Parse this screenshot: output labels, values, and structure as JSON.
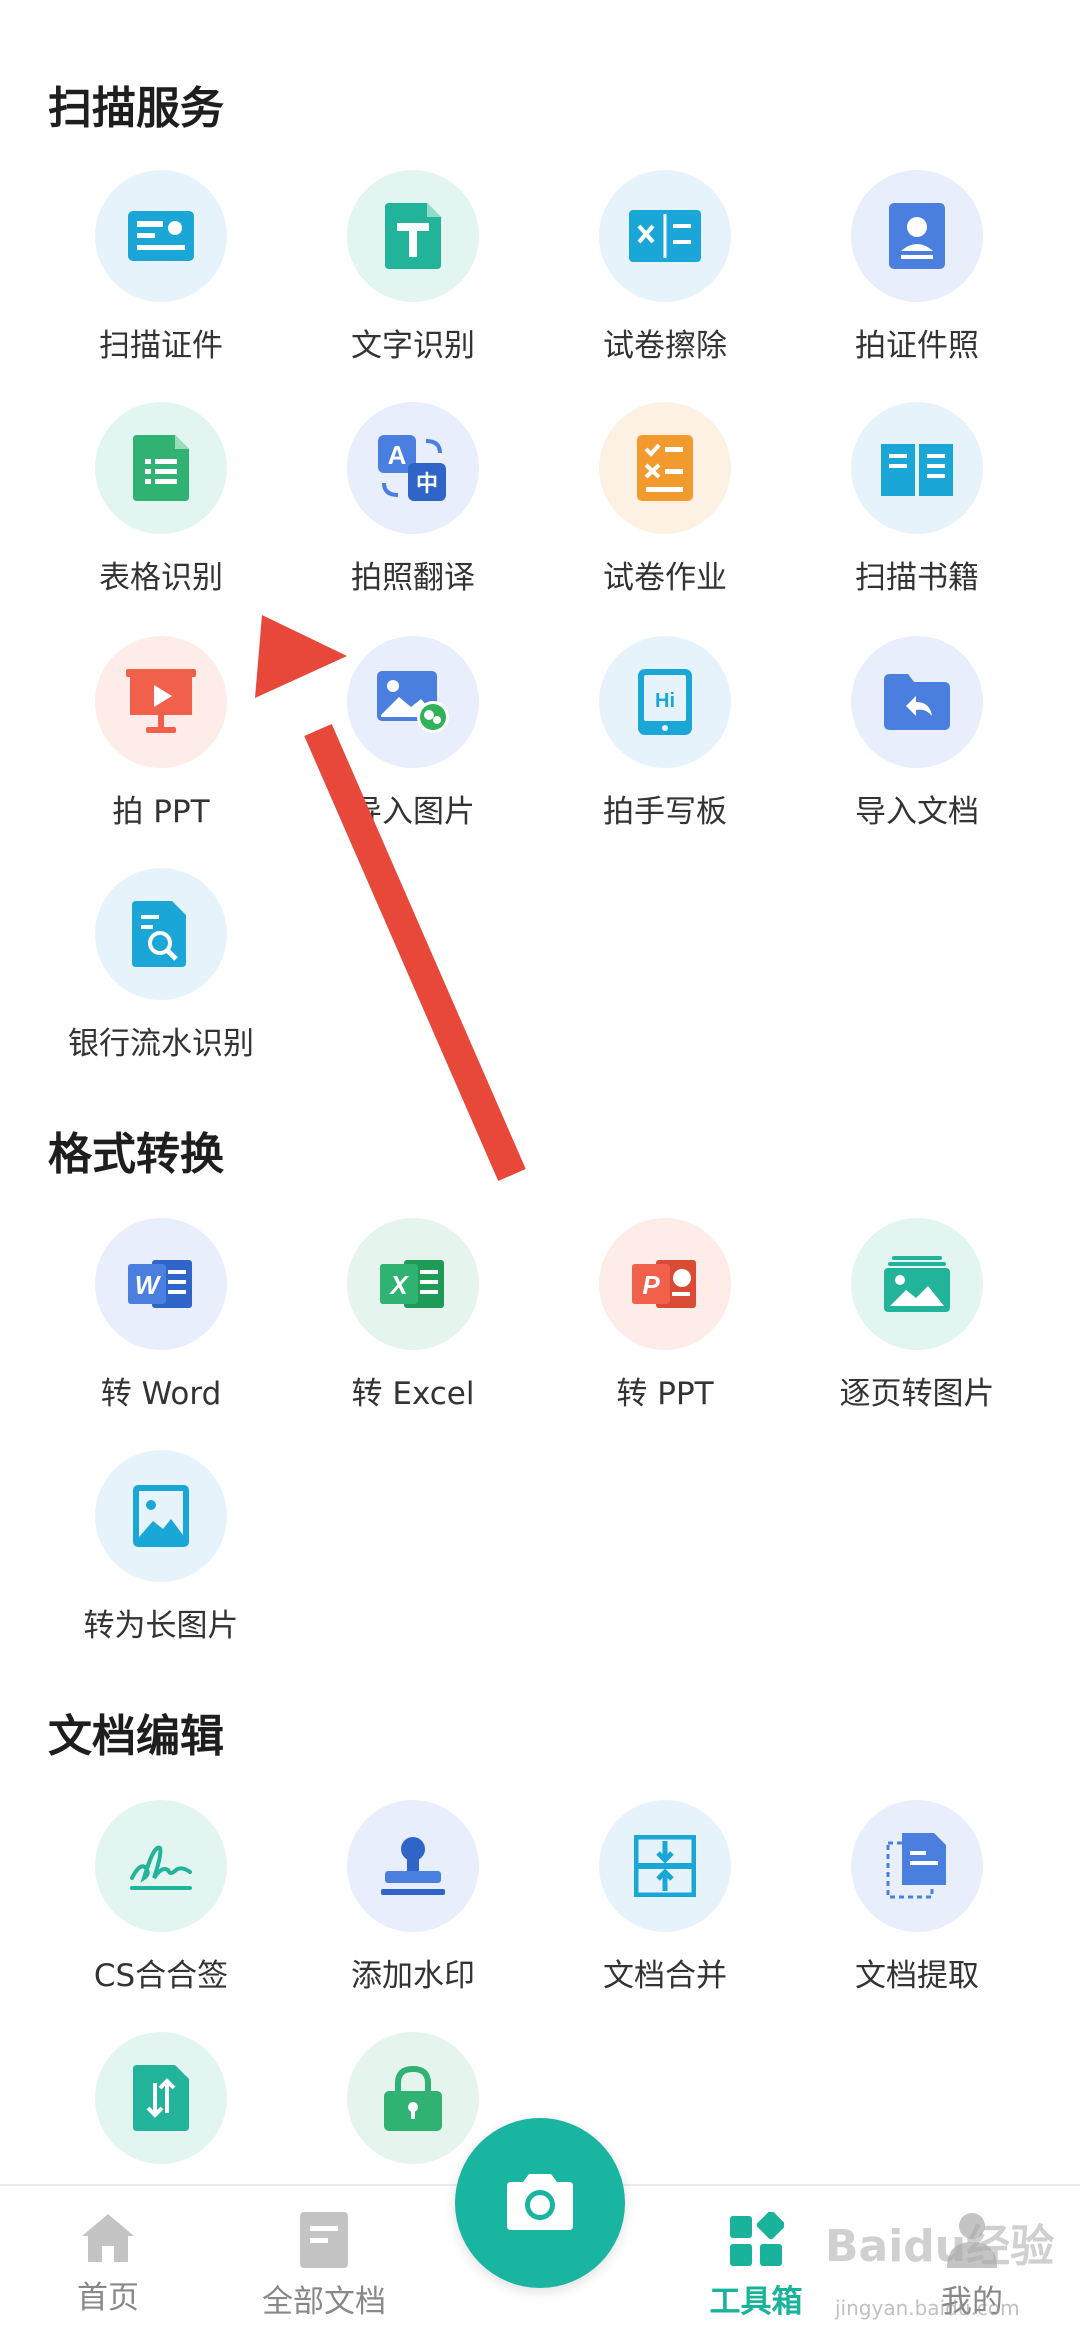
{
  "sections": [
    {
      "title": "扫描服务",
      "tools": [
        {
          "label": "扫描证件",
          "icon": "id-card-icon"
        },
        {
          "label": "文字识别",
          "icon": "text-t-icon"
        },
        {
          "label": "试卷擦除",
          "icon": "erase-book-icon"
        },
        {
          "label": "拍证件照",
          "icon": "id-photo-icon"
        },
        {
          "label": "表格识别",
          "icon": "spreadsheet-icon"
        },
        {
          "label": "拍照翻译",
          "icon": "translate-icon"
        },
        {
          "label": "试卷作业",
          "icon": "homework-icon"
        },
        {
          "label": "扫描书籍",
          "icon": "open-book-icon"
        },
        {
          "label": "拍 PPT",
          "icon": "presentation-icon"
        },
        {
          "label": "导入图片",
          "icon": "import-image-icon"
        },
        {
          "label": "拍手写板",
          "icon": "tablet-icon"
        },
        {
          "label": "导入文档",
          "icon": "import-folder-icon"
        },
        {
          "label": "银行流水识别",
          "icon": "bank-statement-icon"
        }
      ]
    },
    {
      "title": "格式转换",
      "tools": [
        {
          "label": "转 Word",
          "icon": "word-icon"
        },
        {
          "label": "转 Excel",
          "icon": "excel-icon"
        },
        {
          "label": "转 PPT",
          "icon": "ppt-icon"
        },
        {
          "label": "逐页转图片",
          "icon": "pages-to-image-icon"
        },
        {
          "label": "转为长图片",
          "icon": "long-image-icon"
        }
      ]
    },
    {
      "title": "文档编辑",
      "tools": [
        {
          "label": "CS合合签",
          "icon": "signature-icon"
        },
        {
          "label": "添加水印",
          "icon": "stamp-icon"
        },
        {
          "label": "文档合并",
          "icon": "merge-icon"
        },
        {
          "label": "文档提取",
          "icon": "extract-icon"
        },
        {
          "label": "",
          "icon": "sort-document-icon"
        },
        {
          "label": "",
          "icon": "lock-icon"
        }
      ]
    }
  ],
  "nav": {
    "home": "首页",
    "all_docs": "全部文档",
    "toolbox": "工具箱",
    "mine": "我的"
  },
  "watermark": {
    "brand": "Baidu经验",
    "url": "jingyan.baidu.com"
  },
  "colors": {
    "accent": "#19b5a0",
    "blue_icon": "#1aa7d8",
    "teal_icon": "#22b49a",
    "indigo_icon": "#4a7fe0",
    "orange_icon": "#f39a2e",
    "red_icon": "#f0604a",
    "arrow": "#e8483a"
  }
}
